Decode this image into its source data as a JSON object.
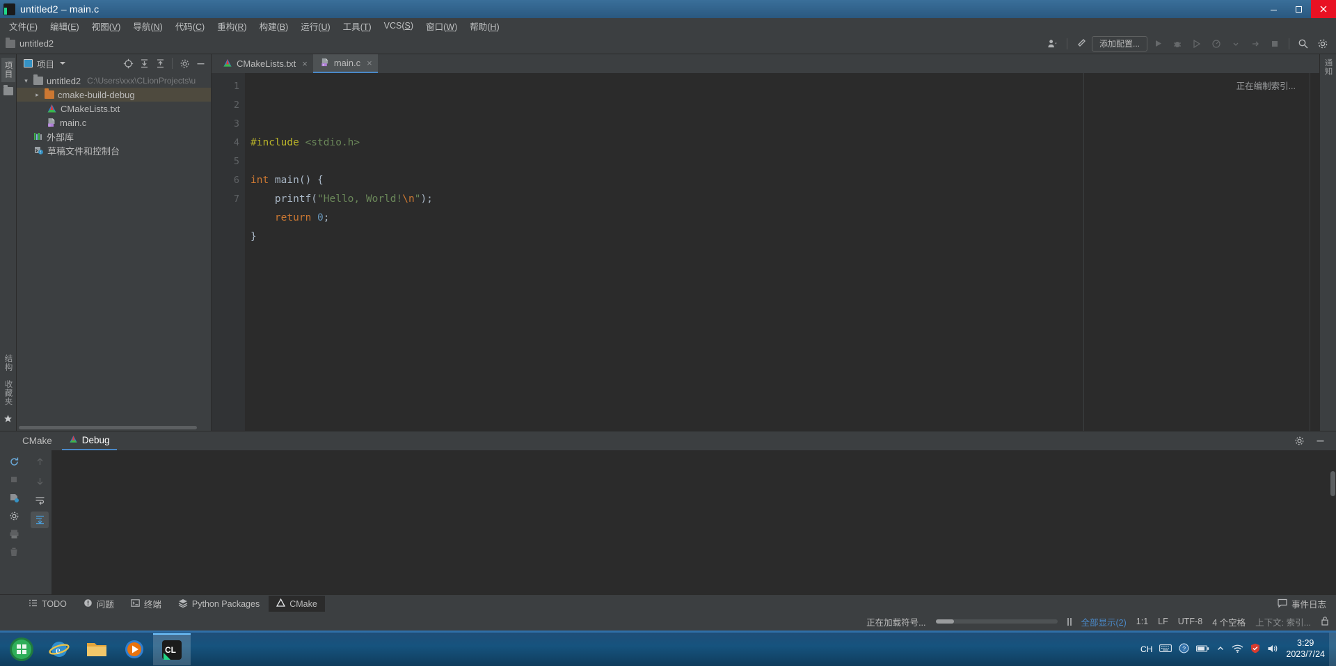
{
  "window": {
    "title": "untitled2 – main.c",
    "app_icon": "clion-icon",
    "minimize": "minimize-icon",
    "maximize": "maximize-icon",
    "close": "close-icon"
  },
  "menubar": [
    {
      "label": "文件",
      "mnemonic": "F"
    },
    {
      "label": "编辑",
      "mnemonic": "E"
    },
    {
      "label": "视图",
      "mnemonic": "V"
    },
    {
      "label": "导航",
      "mnemonic": "N"
    },
    {
      "label": "代码",
      "mnemonic": "C"
    },
    {
      "label": "重构",
      "mnemonic": "R"
    },
    {
      "label": "构建",
      "mnemonic": "B"
    },
    {
      "label": "运行",
      "mnemonic": "U"
    },
    {
      "label": "工具",
      "mnemonic": "T"
    },
    {
      "label": "VCS",
      "mnemonic": "S"
    },
    {
      "label": "窗口",
      "mnemonic": "W"
    },
    {
      "label": "帮助",
      "mnemonic": "H"
    }
  ],
  "navbar": {
    "breadcrumb": "untitled2",
    "add_configuration": "添加配置...",
    "icons": [
      "account-icon",
      "chevron-down-icon",
      "build-hammer-icon",
      "run-icon",
      "debug-icon",
      "run-with-coverage-icon",
      "profile-icon",
      "chevron-down-icon",
      "attach-icon",
      "stop-icon",
      "search-icon",
      "settings-gear-icon"
    ]
  },
  "left_stripe": {
    "project_tab": "项目",
    "structure_tab": "结构",
    "favorites_tab": "收藏夹",
    "bookmark_icon": "star-icon"
  },
  "project_panel": {
    "header_title": "项目",
    "header_icons": [
      "locate-target-icon",
      "expand-all-icon",
      "collapse-all-icon",
      "settings-gear-icon",
      "hide-minus-icon"
    ],
    "tree": [
      {
        "label": "untitled2",
        "path": "C:\\Users\\xxx\\CLionProjects\\u",
        "icon": "folder-icon",
        "arrow": "expanded",
        "indent": 0,
        "selected": false
      },
      {
        "label": "cmake-build-debug",
        "path": "",
        "icon": "folder-orange-icon",
        "arrow": "collapsed",
        "indent": 1,
        "selected": true
      },
      {
        "label": "CMakeLists.txt",
        "path": "",
        "icon": "cmake-file-icon",
        "arrow": "none",
        "indent": 1,
        "selected": false
      },
      {
        "label": "main.c",
        "path": "",
        "icon": "c-file-icon",
        "arrow": "none",
        "indent": 1,
        "selected": false
      },
      {
        "label": "外部库",
        "path": "",
        "icon": "external-libraries-icon",
        "arrow": "none",
        "indent": 0,
        "selected": false
      },
      {
        "label": "草稿文件和控制台",
        "path": "",
        "icon": "scratches-icon",
        "arrow": "none",
        "indent": 0,
        "selected": false
      }
    ]
  },
  "editor": {
    "tabs": [
      {
        "label": "CMakeLists.txt",
        "icon": "cmake-file-icon",
        "active": false,
        "close": "×"
      },
      {
        "label": "main.c",
        "icon": "c-file-icon",
        "active": true,
        "close": "×"
      }
    ],
    "indexing_note": "正在编制索引...",
    "line_numbers": [
      "1",
      "2",
      "3",
      "4",
      "5",
      "6",
      "7"
    ],
    "code_lines": [
      [
        {
          "t": "#include",
          "c": "k-pre"
        },
        {
          "t": " ",
          "c": "k-plain"
        },
        {
          "t": "<stdio.h>",
          "c": "k-inc"
        }
      ],
      [],
      [
        {
          "t": "int",
          "c": "k-kw"
        },
        {
          "t": " main() {",
          "c": "k-plain"
        }
      ],
      [
        {
          "t": "    printf(",
          "c": "k-plain"
        },
        {
          "t": "\"Hello, World!",
          "c": "k-str"
        },
        {
          "t": "\\n",
          "c": "k-esc"
        },
        {
          "t": "\"",
          "c": "k-str"
        },
        {
          "t": ");",
          "c": "k-plain"
        }
      ],
      [
        {
          "t": "    ",
          "c": "k-plain"
        },
        {
          "t": "return",
          "c": "k-kw"
        },
        {
          "t": " ",
          "c": "k-plain"
        },
        {
          "t": "0",
          "c": "k-num"
        },
        {
          "t": ";",
          "c": "k-plain"
        }
      ],
      [
        {
          "t": "}",
          "c": "k-plain"
        }
      ],
      []
    ]
  },
  "bottom_window": {
    "tabs": [
      {
        "label": "CMake",
        "icon": "",
        "active": false
      },
      {
        "label": "Debug",
        "icon": "cmake-triangle-icon",
        "active": true
      }
    ],
    "header_icons": [
      "settings-gear-icon",
      "hide-minus-icon"
    ],
    "left_tools": [
      "rerun-icon",
      "stop-icon",
      "build-icon",
      "settings-gear-icon",
      "print-icon",
      "delete-icon"
    ],
    "left_tools2": [
      "scroll-up-icon",
      "scroll-down-icon",
      "soft-wrap-icon",
      "scroll-to-end-icon"
    ]
  },
  "bottom_tabs": {
    "items": [
      {
        "label": "TODO",
        "icon": "todo-list-icon",
        "active": false
      },
      {
        "label": "问题",
        "icon": "problems-icon",
        "active": false
      },
      {
        "label": "终端",
        "icon": "terminal-icon",
        "active": false
      },
      {
        "label": "Python Packages",
        "icon": "python-packages-icon",
        "active": false
      },
      {
        "label": "CMake",
        "icon": "cmake-triangle-icon",
        "active": true
      }
    ],
    "event_log": "事件日志",
    "event_log_icon": "message-icon"
  },
  "statusbar": {
    "loading_text": "正在加载符号...",
    "progress_percent": 15,
    "pause_icon": "pause-icon",
    "show_all": "全部显示(2)",
    "caret_position": "1:1",
    "line_separator": "LF",
    "encoding": "UTF-8",
    "indent": "4 个空格",
    "context": "上下文: 索引...",
    "lock_icon": "lock-icon"
  },
  "taskbar": {
    "buttons": [
      "start-orb-icon",
      "internet-explorer-icon",
      "file-explorer-icon",
      "media-player-icon",
      "clion-icon"
    ],
    "tray": [
      "input-method-cn",
      "keyboard-icon",
      "help-icon",
      "battery-icon",
      "chevron-up-icon",
      "network-icon",
      "shield-icon",
      "volume-icon"
    ],
    "input_method": "CH",
    "clock_time": "3:29",
    "clock_date": "2023/7/24"
  },
  "colors": {
    "accent": "#4a88c7",
    "editor_bg": "#2b2b2b",
    "panel_bg": "#3c3f41",
    "selection": "#4e4a3e"
  }
}
